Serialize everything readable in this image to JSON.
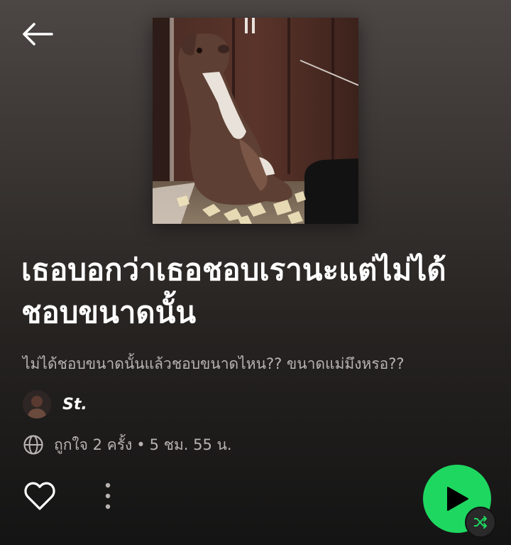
{
  "header": {
    "back_icon": "arrow-left-icon"
  },
  "cover": {
    "description_icon": "playlist-cover-image"
  },
  "playlist": {
    "title": "เธอบอกว่าเธอชอบเรานะแต่ไม่ได้ชอบขนาดนั้น",
    "description": "ไม่ได้ชอบขนาดนั้นแล้วชอบขนาดไหน?? ขนาดแม่มึงหรอ??",
    "owner_name": "St.",
    "likes_text": "ถูกใจ 2 ครั้ง",
    "separator": "•",
    "duration_text": "5 ชม. 55 น."
  },
  "actions": {
    "like_icon": "heart-outline-icon",
    "more_icon": "more-vertical-icon",
    "play_icon": "play-icon",
    "shuffle_icon": "shuffle-icon"
  },
  "colors": {
    "accent": "#1ed760",
    "text_secondary": "#b8b3b1",
    "background_top": "#4c4644",
    "background_bottom": "#141414"
  }
}
